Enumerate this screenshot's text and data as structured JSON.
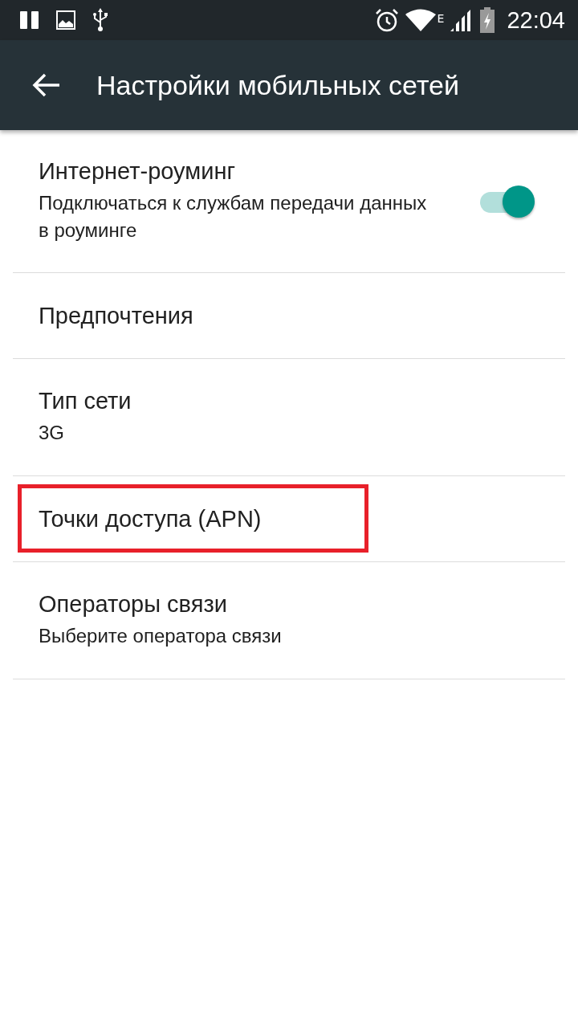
{
  "status_bar": {
    "network_type": "E",
    "time": "22:04"
  },
  "app_bar": {
    "title": "Настройки мобильных сетей"
  },
  "items": [
    {
      "kind": "switch",
      "title": "Интернет-роуминг",
      "summary": "Подключаться к службам передачи данных в роуминге",
      "checked": true,
      "highlighted": false
    },
    {
      "kind": "plain",
      "title": "Предпочтения",
      "highlighted": false
    },
    {
      "kind": "plain",
      "title": "Тип сети",
      "summary": "3G",
      "highlighted": false
    },
    {
      "kind": "plain",
      "title": "Точки доступа (APN)",
      "highlighted": true
    },
    {
      "kind": "plain",
      "title": "Операторы связи",
      "summary": "Выберите оператора связи",
      "highlighted": false
    }
  ]
}
